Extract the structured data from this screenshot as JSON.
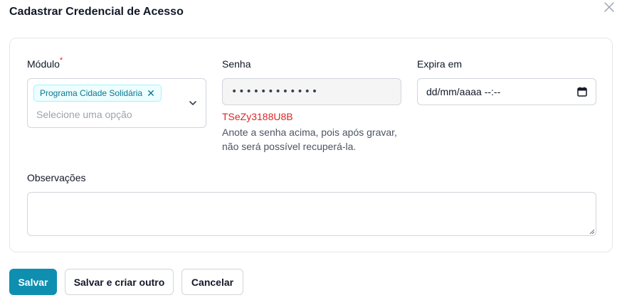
{
  "dialog": {
    "title": "Cadastrar Credencial de Acesso"
  },
  "form": {
    "modulo": {
      "label": "Módulo",
      "required_mark": "*",
      "selected_chip": "Programa Cidade Solidária",
      "placeholder": "Selecione uma opção"
    },
    "senha": {
      "label": "Senha",
      "masked_value": "••••••••••••",
      "plain_value": "TSeZy3188U8B",
      "hint": "Anote a senha acima, pois após gravar, não será possível recuperá-la."
    },
    "expira_em": {
      "label": "Expira em",
      "value": "dd/mm/aaaa --:--"
    },
    "observacoes": {
      "label": "Observações",
      "value": ""
    }
  },
  "actions": {
    "save": "Salvar",
    "save_and_new": "Salvar e criar outro",
    "cancel": "Cancelar"
  },
  "colors": {
    "primary": "#0e8fb0",
    "chip_bg": "#ecfeff",
    "chip_text": "#0e7490",
    "error_text": "#dc2626",
    "border": "#d1d5db"
  },
  "icons": {
    "close": "close-icon",
    "chevron": "chevron-down-icon",
    "calendar": "calendar-icon",
    "chip_remove": "x-icon",
    "resize": "resize-grip-icon"
  }
}
